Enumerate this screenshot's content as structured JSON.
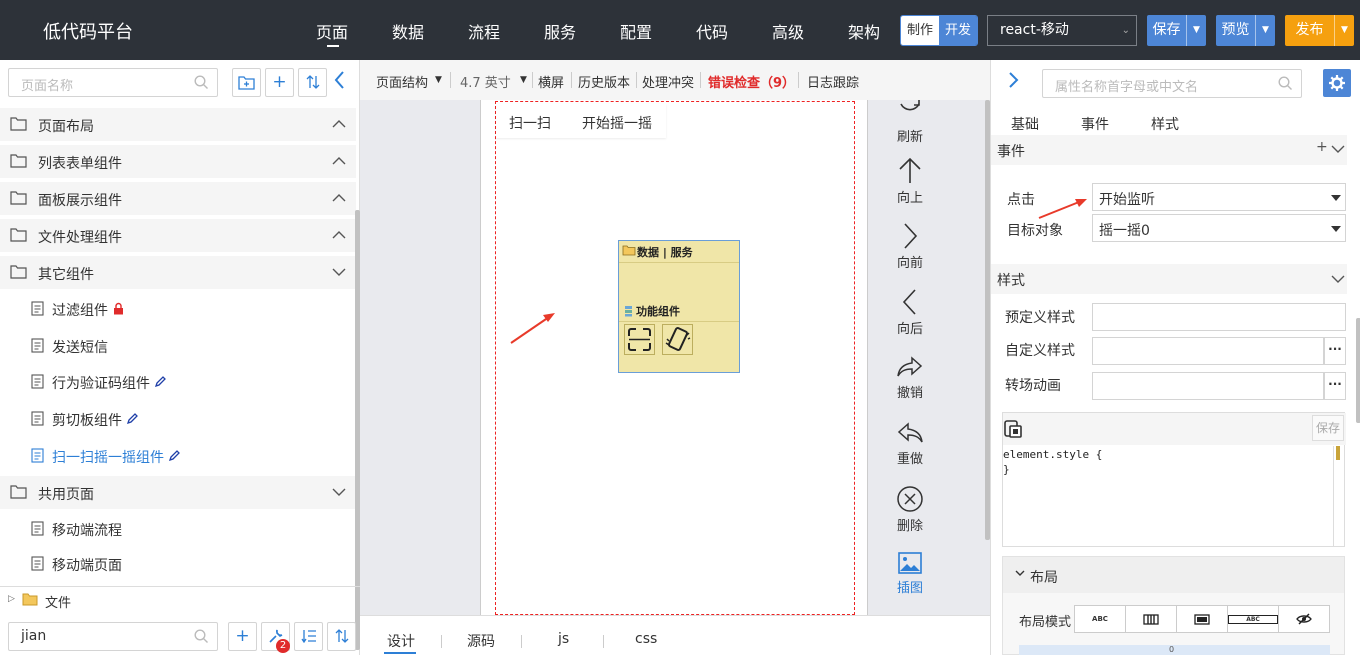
{
  "header": {
    "brand": "低代码平台",
    "nav": [
      "页面",
      "数据",
      "流程",
      "服务",
      "配置",
      "代码",
      "高级",
      "架构"
    ],
    "mode": {
      "make": "制作",
      "dev": "开发"
    },
    "project": "react-移动",
    "save": "保存",
    "preview": "预览",
    "publish": "发布"
  },
  "left": {
    "search_placeholder": "页面名称",
    "groups": [
      "页面布局",
      "列表表单组件",
      "面板展示组件",
      "文件处理组件",
      "其它组件"
    ],
    "items": [
      "过滤组件",
      "发送短信",
      "行为验证码组件",
      "剪切板组件",
      "扫一扫摇一摇组件"
    ],
    "shared_group": "共用页面",
    "shared_items": [
      "移动端流程",
      "移动端页面"
    ],
    "file": "文件",
    "bottom_search": "jian",
    "tool_badge": "2"
  },
  "center": {
    "toolbar": {
      "structure": "页面结构",
      "size": "4.7 英寸",
      "landscape": "横屏",
      "history": "历史版本",
      "conflict": "处理冲突",
      "error": "错误检查（9）",
      "log": "日志跟踪"
    },
    "tabs": [
      "扫一扫",
      "开始摇一摇"
    ],
    "widget": {
      "title": "数据 | 服务",
      "func": "功能组件"
    },
    "tools": [
      "刷新",
      "向上",
      "向前",
      "向后",
      "撤销",
      "重做",
      "删除",
      "插图"
    ],
    "bottom_tabs": [
      "设计",
      "源码",
      "js",
      "css"
    ]
  },
  "right": {
    "search_placeholder": "属性名称首字母或中文名",
    "tabs": [
      "基础",
      "事件",
      "样式"
    ],
    "event_section": "事件",
    "event_add": "+",
    "click_label": "点击",
    "click_value": "开始监听",
    "target_label": "目标对象",
    "target_value": "摇一摇0",
    "style_section": "样式",
    "preset_label": "预定义样式",
    "custom_label": "自定义样式",
    "transition_label": "转场动画",
    "more": "···",
    "editor_save": "保存",
    "code_line1": "element.style {",
    "code_line2": "}",
    "layout_section": "布局",
    "layout_mode": "布局模式",
    "layout_icons": [
      "ABC",
      "|||",
      "ABC"
    ],
    "bar_value": "0"
  },
  "colors": {
    "accent": "#2d7fd6",
    "topbar": "#2d3239",
    "publish": "#f5a00f",
    "error": "#e02b2b"
  }
}
